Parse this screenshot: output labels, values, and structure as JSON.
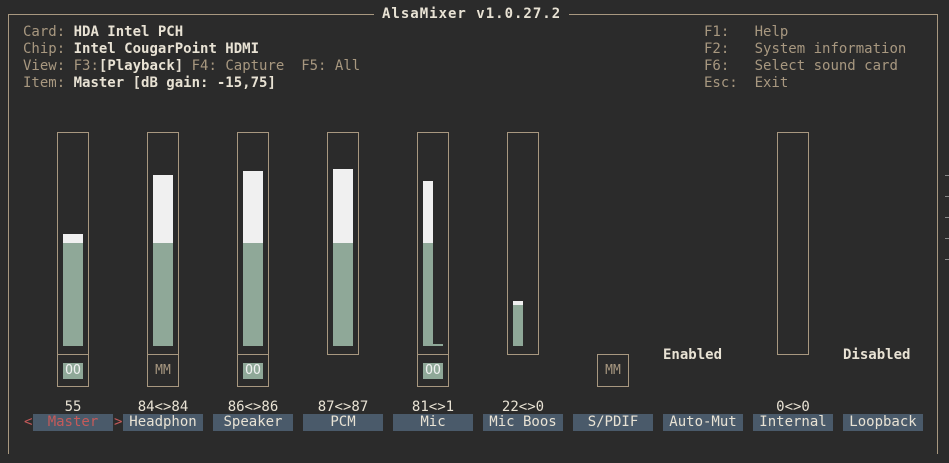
{
  "title": "AlsaMixer v1.0.27.2",
  "info": {
    "card_label": "Card:",
    "card_value": "HDA Intel PCH",
    "chip_label": "Chip:",
    "chip_value": "Intel CougarPoint HDMI",
    "view_label": "View:",
    "view_f3": "F3:",
    "view_playback": "[Playback]",
    "view_capture": "F4: Capture",
    "view_all": "F5: All",
    "item_label": "Item:",
    "item_value": "Master [dB gain: -15,75]"
  },
  "help": {
    "f1_key": "F1:",
    "f1_text": "Help",
    "f2_key": "F2:",
    "f2_text": "System information",
    "f6_key": "F6:",
    "f6_text": "Select sound card",
    "esc_key": "Esc:",
    "esc_text": "Exit"
  },
  "controls": [
    {
      "name": "Master",
      "value": "55",
      "level_left": 0.55,
      "level_right": 0.55,
      "switch": "OO",
      "switch_on": true
    },
    {
      "name": "Headphon",
      "value": "84<>84",
      "level_left": 0.84,
      "level_right": 0.84,
      "switch": "MM",
      "switch_on": false
    },
    {
      "name": "Speaker",
      "value": "86<>86",
      "level_left": 0.86,
      "level_right": 0.86,
      "switch": "OO",
      "switch_on": true
    },
    {
      "name": "PCM",
      "value": "87<>87",
      "level_left": 0.87,
      "level_right": 0.87,
      "switch": "",
      "switch_on": null
    },
    {
      "name": "Mic",
      "value": "81<>1",
      "level_left": 0.81,
      "level_right": 0.01,
      "switch": "OO",
      "switch_on": true
    },
    {
      "name": "Mic Boos",
      "value": "22<>0",
      "level_left": 0.22,
      "level_right": 0.0,
      "switch": "",
      "switch_on": null
    },
    {
      "name": "S/PDIF",
      "value": "",
      "switch": "MM",
      "switch_on": false
    },
    {
      "name": "Auto-Mut",
      "value": "",
      "status": "Enabled"
    },
    {
      "name": "Internal",
      "value": "0<>0",
      "level_left": 0.0,
      "level_right": 0.0
    },
    {
      "name": "Loopback",
      "value": "",
      "status": "Disabled"
    }
  ],
  "selection_arrows": {
    "left": "<",
    "right": ">"
  },
  "colors": {
    "background": "#2b2b2b",
    "frame": "#a89880",
    "bar_high": "#f0f0f0",
    "bar_low": "#8fa898",
    "label_bg": "#4a5a6a",
    "selected_text": "#c55a5a"
  }
}
